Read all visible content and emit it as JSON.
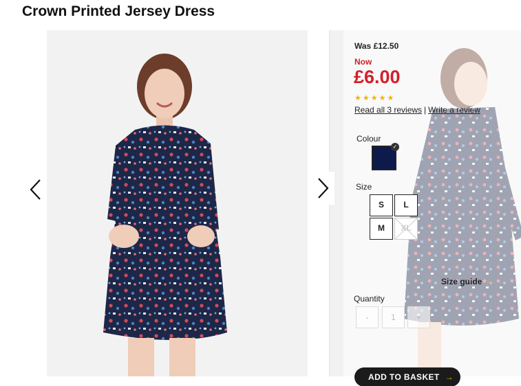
{
  "product": {
    "title": "Crown Printed Jersey Dress"
  },
  "pricing": {
    "was": "Was £12.50",
    "now_label": "Now",
    "price": "£6.00"
  },
  "rating": {
    "stars": "★★★★★",
    "read_reviews": "Read all 3 reviews",
    "separator": "|",
    "write_review": "Write a review"
  },
  "colour": {
    "label": "Colour",
    "selected": "#0d1a4b"
  },
  "size": {
    "label": "Size",
    "options": [
      "S",
      "L",
      "M",
      "XL"
    ]
  },
  "size_guide": {
    "label": "Size guide",
    "arrow": "→"
  },
  "quantity": {
    "label": "Quantity",
    "minus": "-",
    "value": "1",
    "plus": "+"
  },
  "basket": {
    "label": "ADD TO BASKET",
    "arrow": "→"
  },
  "colors": {
    "price_red": "#d4202a",
    "accent_yellow": "#f0b400",
    "dress_navy": "#1d2748"
  }
}
